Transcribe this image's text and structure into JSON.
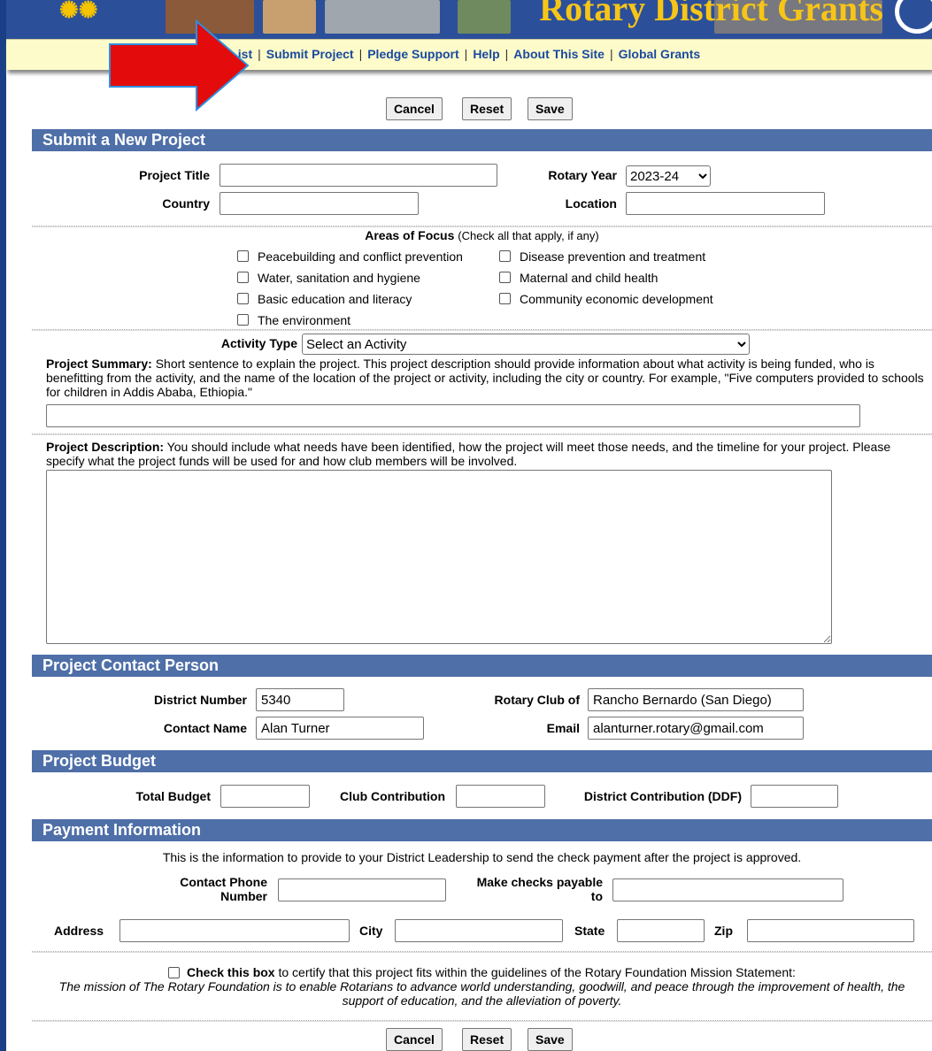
{
  "banner": {
    "title": "Rotary District Grants"
  },
  "nav": {
    "items": [
      "List",
      "Submit Project",
      "Pledge Support",
      "Help",
      "About This Site",
      "Global Grants"
    ],
    "first_visible": "ist",
    "separator": "|"
  },
  "buttons": {
    "cancel": "Cancel",
    "reset": "Reset",
    "save": "Save"
  },
  "sections": {
    "submit": "Submit a New Project",
    "contact": "Project Contact Person",
    "budget": "Project Budget",
    "payment": "Payment Information"
  },
  "project": {
    "title_label": "Project Title",
    "rotary_year_label": "Rotary Year",
    "rotary_year_value": "2023-24",
    "country_label": "Country",
    "location_label": "Location"
  },
  "focus": {
    "heading_bold": "Areas of Focus",
    "heading_note": "(Check all that apply, if any)",
    "options": [
      "Peacebuilding and conflict prevention",
      "Disease prevention and treatment",
      "Water, sanitation and hygiene",
      "Maternal and child health",
      "Basic education and literacy",
      "Community economic development",
      "The environment"
    ]
  },
  "activity": {
    "label": "Activity Type",
    "selected": "Select an Activity"
  },
  "summary": {
    "label": "Project Summary:",
    "text": "Short sentence to explain the project. This project description should provide information about what activity is being funded, who is benefitting from the activity, and the name of the location of the project or activity, including the city or country. For example, \"Five computers provided to schools for children in Addis Ababa, Ethiopia.\""
  },
  "description": {
    "label": "Project Description:",
    "text": "You should include what needs have been identified, how the project will meet those needs, and the timeline for your project. Please specify what the project funds will be used for and how club members will be involved."
  },
  "contact": {
    "district_label": "District Number",
    "district_value": "5340",
    "club_label": "Rotary Club of",
    "club_value": "Rancho Bernardo (San Diego)",
    "name_label": "Contact Name",
    "name_value": "Alan Turner",
    "email_label": "Email",
    "email_value": "alanturner.rotary@gmail.com"
  },
  "budget": {
    "total_label": "Total Budget",
    "club_label": "Club Contribution",
    "district_label": "District Contribution (DDF)"
  },
  "payment": {
    "note": "This is the information to provide to your District Leadership to send the check payment after the project is approved.",
    "phone_label_1": "Contact Phone",
    "phone_label_2": "Number",
    "payable_label_1": "Make checks payable",
    "payable_label_2": "to",
    "address_label": "Address",
    "city_label": "City",
    "state_label": "State",
    "zip_label": "Zip"
  },
  "certify": {
    "bold": "Check this box",
    "text": "to certify that this project fits within the guidelines of the Rotary Foundation Mission Statement:",
    "mission": "The mission of The Rotary Foundation is to enable Rotarians to advance world understanding, goodwill, and peace through the improvement of health, the support of education, and the alleviation of poverty."
  },
  "colors": {
    "section_bg": "#4e6fa8",
    "nav_bg": "#fdfbc9",
    "arrow": "#e30b0b",
    "link": "#1a4aa0"
  }
}
